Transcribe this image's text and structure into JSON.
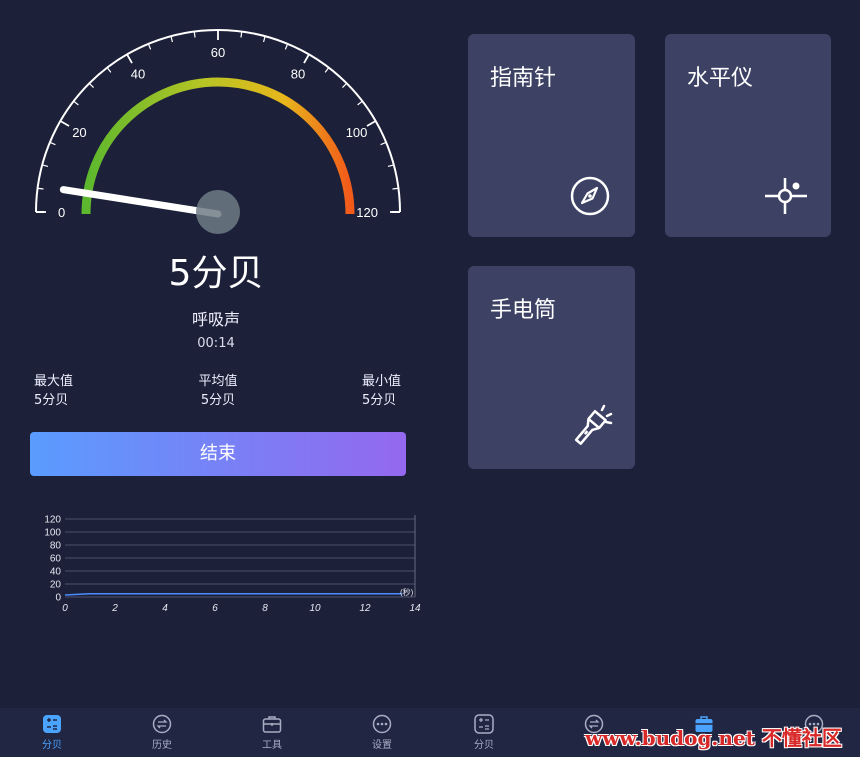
{
  "meter": {
    "scale_ticks": [
      "0",
      "20",
      "40",
      "60",
      "80",
      "100",
      "120"
    ],
    "range": [
      0,
      120
    ],
    "needle_value": 5,
    "decibel_display": "5分贝",
    "sound_label": "呼吸声",
    "timer": "00:14"
  },
  "stats": {
    "max": {
      "label": "最大值",
      "value": "5分贝"
    },
    "avg": {
      "label": "平均值",
      "value": "5分贝"
    },
    "min": {
      "label": "最小值",
      "value": "5分贝"
    }
  },
  "end_button": "结束",
  "chart_data": {
    "type": "line",
    "x": [
      0,
      0.5,
      1,
      1.5,
      2,
      4,
      6,
      8,
      10,
      12,
      13.5
    ],
    "series": [
      {
        "values": [
          3,
          4,
          5,
          5,
          5,
          5,
          5,
          5,
          5,
          5,
          5
        ]
      }
    ],
    "ylim": [
      0,
      120
    ],
    "xlim": [
      0,
      14
    ],
    "yticks": [
      "0",
      "20",
      "40",
      "60",
      "80",
      "100",
      "120"
    ],
    "xticks": [
      "0",
      "2",
      "4",
      "6",
      "8",
      "10",
      "12",
      "14"
    ],
    "end_marker": "(秒)",
    "grid": true,
    "line_color": "#4a8cff"
  },
  "left_tabs": [
    {
      "label": "分贝",
      "icon": "calculator-icon",
      "active": true
    },
    {
      "label": "历史",
      "icon": "history-icon",
      "active": false
    },
    {
      "label": "工具",
      "icon": "toolbox-icon",
      "active": false
    },
    {
      "label": "设置",
      "icon": "more-icon",
      "active": false
    }
  ],
  "tools": [
    {
      "title": "指南针",
      "icon": "compass-icon"
    },
    {
      "title": "水平仪",
      "icon": "level-icon"
    },
    {
      "title": "手电筒",
      "icon": "flashlight-icon"
    }
  ],
  "right_tabs": [
    {
      "label": "分贝",
      "icon": "calculator-icon",
      "active": false
    },
    {
      "label": "",
      "icon": "history-icon",
      "active": false
    },
    {
      "label": "",
      "icon": "toolbox-icon",
      "active": true
    },
    {
      "label": "",
      "icon": "more-icon",
      "active": false
    }
  ],
  "watermark": "www.budog.net 不懂社区",
  "colors": {
    "background": "#1c2038",
    "card": "#3d4264",
    "accent": "#4aa3ff",
    "button_start": "#5a9cff",
    "button_end": "#9468ef"
  }
}
